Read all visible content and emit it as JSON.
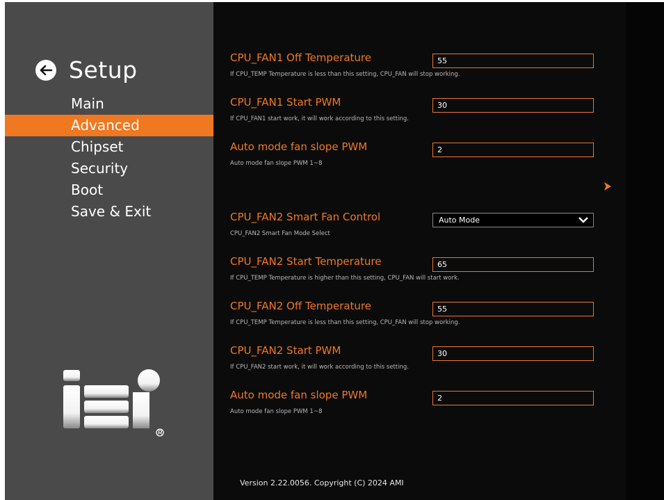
{
  "sidebar": {
    "title": "Setup",
    "nav": [
      {
        "label": "Main",
        "active": false
      },
      {
        "label": "Advanced",
        "active": true
      },
      {
        "label": "Chipset",
        "active": false
      },
      {
        "label": "Security",
        "active": false
      },
      {
        "label": "Boot",
        "active": false
      },
      {
        "label": "Save & Exit",
        "active": false
      }
    ],
    "logo_text": "iEi"
  },
  "settings": [
    {
      "label": "CPU_FAN1 Off Temperature",
      "value": "55",
      "description": "If CPU_TEMP Temperature is less than this setting, CPU_FAN will stop working."
    },
    {
      "label": "CPU_FAN1 Start PWM",
      "value": "30",
      "description": "If CPU_FAN1 start work, it will work according to this setting."
    },
    {
      "label": "Auto mode fan slope PWM",
      "value": "2",
      "description": "Auto mode fan slope PWM 1~8"
    },
    {
      "label": "CPU_FAN2 Smart Fan Control",
      "value": "Auto Mode",
      "description": "CPU_FAN2 Smart Fan Mode Select"
    },
    {
      "label": "CPU_FAN2 Start Temperature",
      "value": "65",
      "description": "If CPU_TEMP Temperature is higher than this setting, CPU_FAN will start work."
    },
    {
      "label": "CPU_FAN2 Off Temperature",
      "value": "55",
      "description": "If CPU_TEMP Temperature is less than this setting, CPU_FAN will stop working."
    },
    {
      "label": "CPU_FAN2 Start PWM",
      "value": "30",
      "description": "If CPU_FAN2 start work, it will work according to this setting."
    },
    {
      "label": "Auto mode fan slope PWM",
      "value": "2",
      "description": "Auto mode fan slope PWM 1~8"
    }
  ],
  "footer": {
    "version": "Version 2.22.0056. Copyright (C) 2024 AMI"
  },
  "colors": {
    "accent": "#f07820",
    "sidebar_bg": "#4a4a4a",
    "main_bg": "#0b0b0b"
  }
}
